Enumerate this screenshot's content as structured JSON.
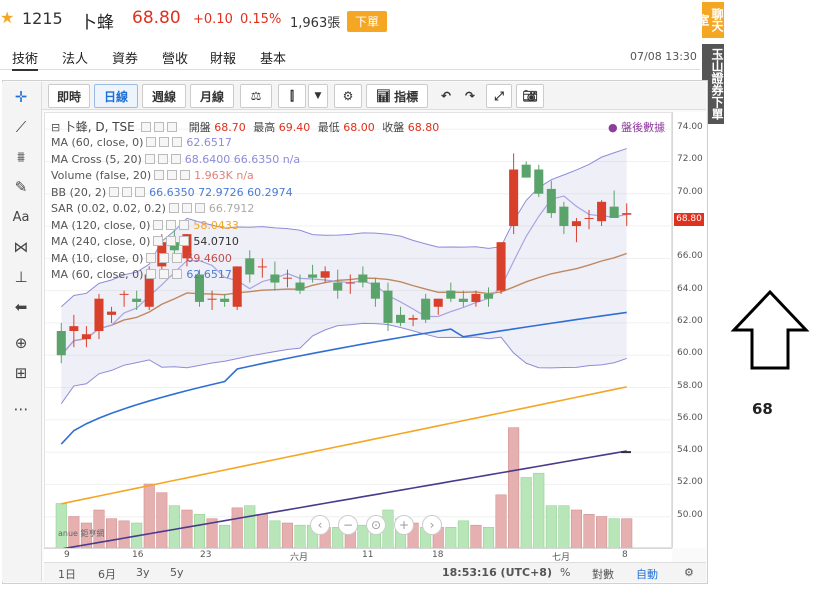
{
  "quote": {
    "star_icon": "star-icon",
    "code": "1215",
    "name": "卜蜂",
    "price": "68.80",
    "change": "+0.10",
    "change_pct": "0.15%",
    "volume": "1,963張",
    "order_button": "下單",
    "colors": {
      "up": "#e0301e",
      "order_bg": "#f5a623"
    }
  },
  "tabs": [
    {
      "label": "技術",
      "active": true
    },
    {
      "label": "法人"
    },
    {
      "label": "資券"
    },
    {
      "label": "營收"
    },
    {
      "label": "財報"
    },
    {
      "label": "基本"
    }
  ],
  "datetime": "07/08 13:30",
  "side_tabs": {
    "chat": "聊天室",
    "trade": "玉山證券下單",
    "chat_bg": "#f5a623",
    "trade_bg": "#555555"
  },
  "toolbar": {
    "buttons": [
      "即時",
      "日線",
      "週線",
      "月線"
    ],
    "selected": "日線",
    "indicator_label": "指標",
    "icons": [
      "balance-icon",
      "candlestick-icon",
      "dropdown-icon",
      "gear-icon",
      "indicator-icon",
      "undo-icon",
      "redo-icon",
      "fullscreen-icon",
      "camera-icon"
    ]
  },
  "left_tools": [
    "crosshair-icon",
    "trend-line-icon",
    "fib-icon",
    "brush-icon",
    "text-icon",
    "pattern-icon",
    "gann-icon",
    "arrow-left-icon",
    "zoom-icon",
    "measure-icon",
    "more-icon"
  ],
  "legend": {
    "symbol": "卜蜂, D, TSE",
    "open_label": "開盤",
    "open": "68.70",
    "high_label": "最高",
    "high": "69.40",
    "low_label": "最低",
    "low": "68.00",
    "close_label": "收盤",
    "close": "68.80",
    "after_hours": "盤後數據",
    "indicators": [
      {
        "label": "MA (60, close, 0)",
        "value": "62.6517",
        "color": "#8e8cd8"
      },
      {
        "label": "MA Cross (5, 20)",
        "value": "68.6400 66.6350 n/a",
        "color": "#8e8cd8"
      },
      {
        "label": "Volume (false, 20)",
        "value": "1.963K n/a",
        "color": "#e08080"
      },
      {
        "label": "BB (20, 2)",
        "value": "66.6350 72.9726 60.2974",
        "color": "#4a7bd4"
      },
      {
        "label": "SAR (0.02, 0.02, 0.2)",
        "value": "66.7912",
        "color": "#aaaaaa"
      },
      {
        "label": "MA (120, close, 0)",
        "value": "58.0433",
        "color": "#f5a623"
      },
      {
        "label": "MA (240, close, 0)",
        "value": "54.0710",
        "color": "#333333"
      },
      {
        "label": "MA (10, close, 0)",
        "value": "69.4600",
        "color": "#c0504d"
      },
      {
        "label": "MA (60, close, 0)",
        "value": "62.6517",
        "color": "#4a7bd4"
      }
    ]
  },
  "price_axis": [
    "74.00",
    "72.00",
    "70.00",
    "68.00",
    "66.00",
    "64.00",
    "62.00",
    "60.00",
    "58.00",
    "56.00",
    "54.00",
    "52.00",
    "50.00"
  ],
  "price_tag": "68.80",
  "date_axis": [
    "9",
    "16",
    "23",
    "六月",
    "11",
    "18",
    "七月",
    "8"
  ],
  "bottom_bar": {
    "ranges": [
      "1日",
      "6月",
      "3y",
      "5y"
    ],
    "time": "18:53:16 (UTC+8)",
    "pct": "%",
    "log": "對數",
    "auto": "自動",
    "gear_icon": "gear-icon"
  },
  "watermark": "anue 鉅亨網",
  "annotation": {
    "label": "68"
  },
  "chart_data": {
    "type": "candlestick",
    "ylim": [
      48,
      75
    ],
    "candles": [
      [
        61.5,
        62.0,
        59.5,
        60.0
      ],
      [
        61.5,
        62.5,
        60.5,
        61.8
      ],
      [
        61.0,
        61.8,
        60.5,
        61.3
      ],
      [
        61.5,
        63.8,
        61.0,
        63.5
      ],
      [
        62.5,
        63.0,
        62.0,
        62.7
      ],
      [
        63.8,
        64.0,
        63.0,
        63.8
      ],
      [
        63.5,
        64.0,
        62.8,
        63.3
      ],
      [
        63.0,
        65.5,
        62.8,
        65.0
      ],
      [
        65.5,
        67.5,
        65.2,
        67.0
      ],
      [
        67.0,
        67.8,
        66.0,
        66.5
      ],
      [
        66.0,
        67.5,
        65.5,
        67.5
      ],
      [
        65.0,
        65.3,
        63.0,
        63.3
      ],
      [
        63.5,
        64.0,
        62.8,
        63.5
      ],
      [
        63.5,
        63.8,
        63.0,
        63.3
      ],
      [
        63.0,
        65.5,
        62.8,
        65.5
      ],
      [
        66.0,
        66.5,
        64.5,
        65.0
      ],
      [
        65.5,
        66.0,
        64.8,
        65.5
      ],
      [
        65.0,
        65.8,
        64.0,
        64.5
      ],
      [
        64.8,
        65.3,
        64.2,
        64.8
      ],
      [
        64.5,
        65.0,
        63.8,
        64.0
      ],
      [
        65.0,
        65.6,
        64.5,
        64.8
      ],
      [
        64.8,
        65.5,
        64.5,
        65.2
      ],
      [
        64.5,
        65.3,
        63.5,
        64.0
      ],
      [
        64.5,
        65.0,
        63.8,
        64.5
      ],
      [
        65.0,
        65.5,
        64.2,
        64.5
      ],
      [
        64.5,
        64.8,
        63.0,
        63.5
      ],
      [
        64.0,
        64.5,
        61.5,
        62.0
      ],
      [
        62.5,
        63.0,
        61.8,
        62.0
      ],
      [
        62.2,
        62.5,
        61.8,
        62.3
      ],
      [
        63.5,
        63.8,
        62.0,
        62.2
      ],
      [
        63.0,
        63.5,
        62.5,
        63.5
      ],
      [
        64.0,
        64.5,
        63.3,
        63.5
      ],
      [
        63.5,
        64.0,
        63.0,
        63.3
      ],
      [
        63.3,
        64.0,
        63.0,
        63.8
      ],
      [
        63.8,
        64.2,
        63.0,
        63.5
      ],
      [
        64.0,
        67.0,
        63.8,
        67.0
      ],
      [
        68.0,
        72.5,
        67.5,
        71.5
      ],
      [
        71.8,
        72.0,
        71.0,
        71.0
      ],
      [
        71.5,
        71.8,
        69.8,
        70.0
      ],
      [
        70.3,
        70.8,
        68.5,
        68.8
      ],
      [
        69.2,
        69.5,
        67.5,
        68.0
      ],
      [
        68.0,
        68.5,
        67.0,
        68.3
      ],
      [
        68.5,
        69.0,
        67.8,
        68.5
      ],
      [
        68.3,
        69.6,
        68.0,
        69.5
      ],
      [
        69.2,
        70.2,
        68.5,
        68.5
      ],
      [
        68.7,
        69.4,
        68.0,
        68.8
      ]
    ],
    "volume": [
      2.1,
      1.5,
      1.2,
      1.8,
      1.4,
      1.3,
      1.2,
      3.0,
      2.6,
      2.0,
      1.8,
      1.6,
      1.4,
      1.1,
      1.9,
      2.0,
      1.6,
      1.3,
      1.2,
      1.1,
      1.1,
      1.0,
      1.0,
      1.2,
      1.1,
      1.0,
      1.8,
      1.4,
      1.2,
      1.0,
      1.0,
      1.0,
      1.3,
      1.1,
      1.0,
      2.5,
      5.6,
      3.3,
      3.5,
      2.0,
      2.0,
      1.8,
      1.6,
      1.5,
      1.4,
      1.4
    ],
    "vol_max": 6.0
  }
}
